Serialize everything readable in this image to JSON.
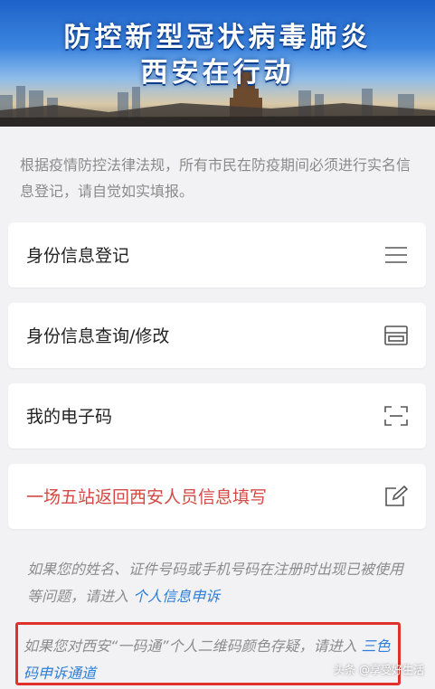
{
  "banner": {
    "title_line1": "防控新型冠状病毒肺炎",
    "title_line2": "西安在行动"
  },
  "notice": "根据疫情防控法律法规，所有市民在防疫期间必须进行实名信息登记，请自觉如实填报。",
  "menu": [
    {
      "label": "身份信息登记",
      "icon": "menu-lines-icon"
    },
    {
      "label": "身份信息查询/修改",
      "icon": "id-card-icon"
    },
    {
      "label": "我的电子码",
      "icon": "scan-frame-icon"
    },
    {
      "label": "一场五站返回西安人员信息填写",
      "icon": "edit-icon",
      "color": "#d24a44"
    }
  ],
  "info1": {
    "text": "如果您的姓名、证件号码或手机号码在注册时出现已被使用等问题，请进入 ",
    "link": "个人信息申诉"
  },
  "info2": {
    "text": "如果您对西安“一码通”个人二维码颜色存疑，请进入 ",
    "link": "三色码申诉通道"
  },
  "watermark": "头条 @享受好生活",
  "colors": {
    "link": "#2f7fd7",
    "highlight_border": "#e0302c",
    "accent_red": "#d24a44"
  }
}
